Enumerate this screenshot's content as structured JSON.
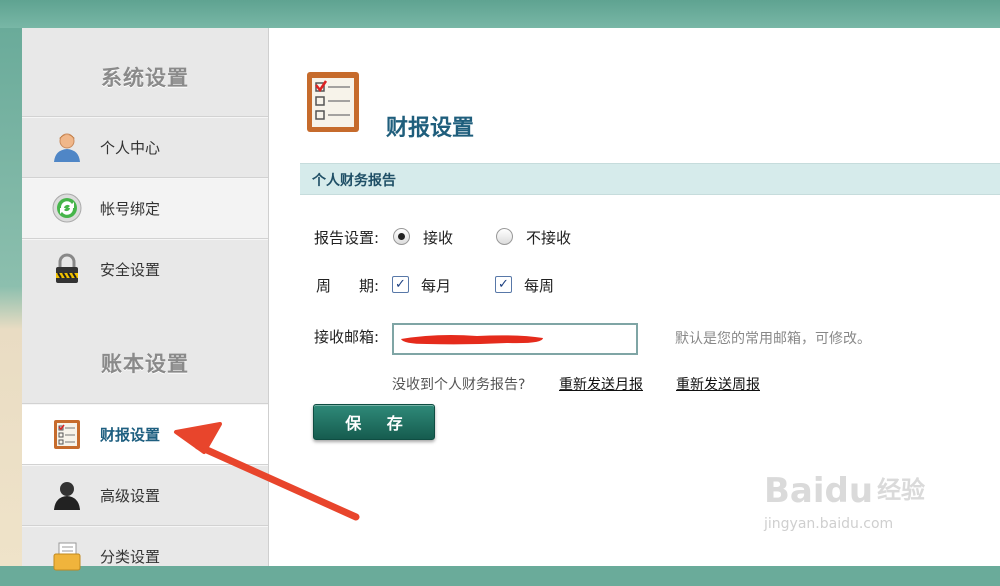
{
  "sidebar": {
    "section1_title": "系统设置",
    "section2_title": "账本设置",
    "items": [
      {
        "label": "个人中心",
        "icon": "user-icon"
      },
      {
        "label": "帐号绑定",
        "icon": "sync-icon"
      },
      {
        "label": "安全设置",
        "icon": "lock-icon"
      },
      {
        "label": "财报设置",
        "icon": "report-icon"
      },
      {
        "label": "高级设置",
        "icon": "user-dark-icon"
      },
      {
        "label": "分类设置",
        "icon": "folder-icon"
      }
    ]
  },
  "main": {
    "page_title": "财报设置",
    "section_title": "个人财务报告",
    "report_label": "报告设置:",
    "report_options": [
      "接收",
      "不接收"
    ],
    "report_selected": "接收",
    "cycle_label_1": "周",
    "cycle_label_2": "期:",
    "cycle_options": [
      "每月",
      "每周"
    ],
    "email_label": "接收邮箱:",
    "email_hint": "默认是您的常用邮箱，可修改。",
    "notice": "没收到个人财务报告?",
    "resend_monthly": "重新发送月报",
    "resend_weekly": "重新发送周报",
    "save_label": "保 存"
  },
  "watermark": {
    "brand": "Baidu",
    "brand_cn": "经验",
    "url": "jingyan.baidu.com"
  },
  "colors": {
    "accent": "#1f5e7c",
    "save_button": "#1f6f61",
    "section_bar": "#d6ebeb",
    "annotation_arrow": "#e8452c"
  }
}
